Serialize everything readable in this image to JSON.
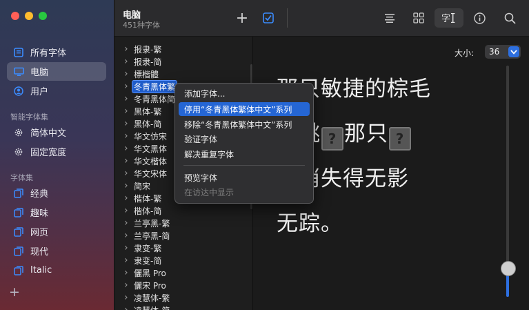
{
  "sidebar": {
    "items": [
      {
        "label": "所有字体",
        "icon": "font-book-icon"
      },
      {
        "label": "电脑",
        "icon": "computer-icon",
        "active": true
      },
      {
        "label": "用户",
        "icon": "user-icon"
      }
    ],
    "smart_header": "智能字体集",
    "smart_items": [
      {
        "label": "简体中文",
        "icon": "gear-icon"
      },
      {
        "label": "固定宽度",
        "icon": "gear-icon"
      }
    ],
    "collections_header": "字体集",
    "collections": [
      {
        "label": "经典",
        "icon": "collection-icon"
      },
      {
        "label": "趣味",
        "icon": "collection-icon"
      },
      {
        "label": "网页",
        "icon": "collection-icon"
      },
      {
        "label": "现代",
        "icon": "collection-icon"
      },
      {
        "label": "Italic",
        "icon": "collection-icon"
      }
    ],
    "add_label": "+"
  },
  "toolbar": {
    "title": "电脑",
    "subtitle": "451种字体",
    "add_label": "+"
  },
  "font_list": [
    "报隶-繁",
    "报隶-简",
    "標楷體",
    "冬青黑体繁",
    "冬青黑体简",
    "黑体-繁",
    "黑体-简",
    "华文仿宋",
    "华文黑体",
    "华文楷体",
    "华文宋体",
    "简宋",
    "楷体-繁",
    "楷体-简",
    "兰亭黑-繁",
    "兰亭黑-简",
    "隶变-繁",
    "隶变-简",
    "儷黑 Pro",
    "儷宋 Pro",
    "凌慧体-繁",
    "凌慧体-简"
  ],
  "selected_font_index": 3,
  "preview": {
    "size_label": "大小:",
    "size_value": "36",
    "line1": "那只敏捷的棕毛",
    "line2a": "狸跳",
    "glyph": "?",
    "line2b": "那只",
    "line3": "。消失得无影",
    "line4": "无踪。",
    "slider_value": 0.12
  },
  "context_menu": {
    "items": [
      {
        "label": "添加字体...",
        "state": "normal"
      },
      {
        "label": "停用“冬青黑体繁体中文”系列",
        "state": "highlighted"
      },
      {
        "label": "移除“冬青黑体繁体中文”系列",
        "state": "normal"
      },
      {
        "label": "验证字体",
        "state": "normal"
      },
      {
        "label": "解决重复字体",
        "state": "normal"
      },
      {
        "label": "预览字体",
        "state": "normal"
      },
      {
        "label": "在访达中显示",
        "state": "disabled"
      }
    ]
  },
  "colors": {
    "accent": "#2566d4",
    "sidebar_top": "#2e3a55",
    "sidebar_bottom": "#6a2a33"
  }
}
